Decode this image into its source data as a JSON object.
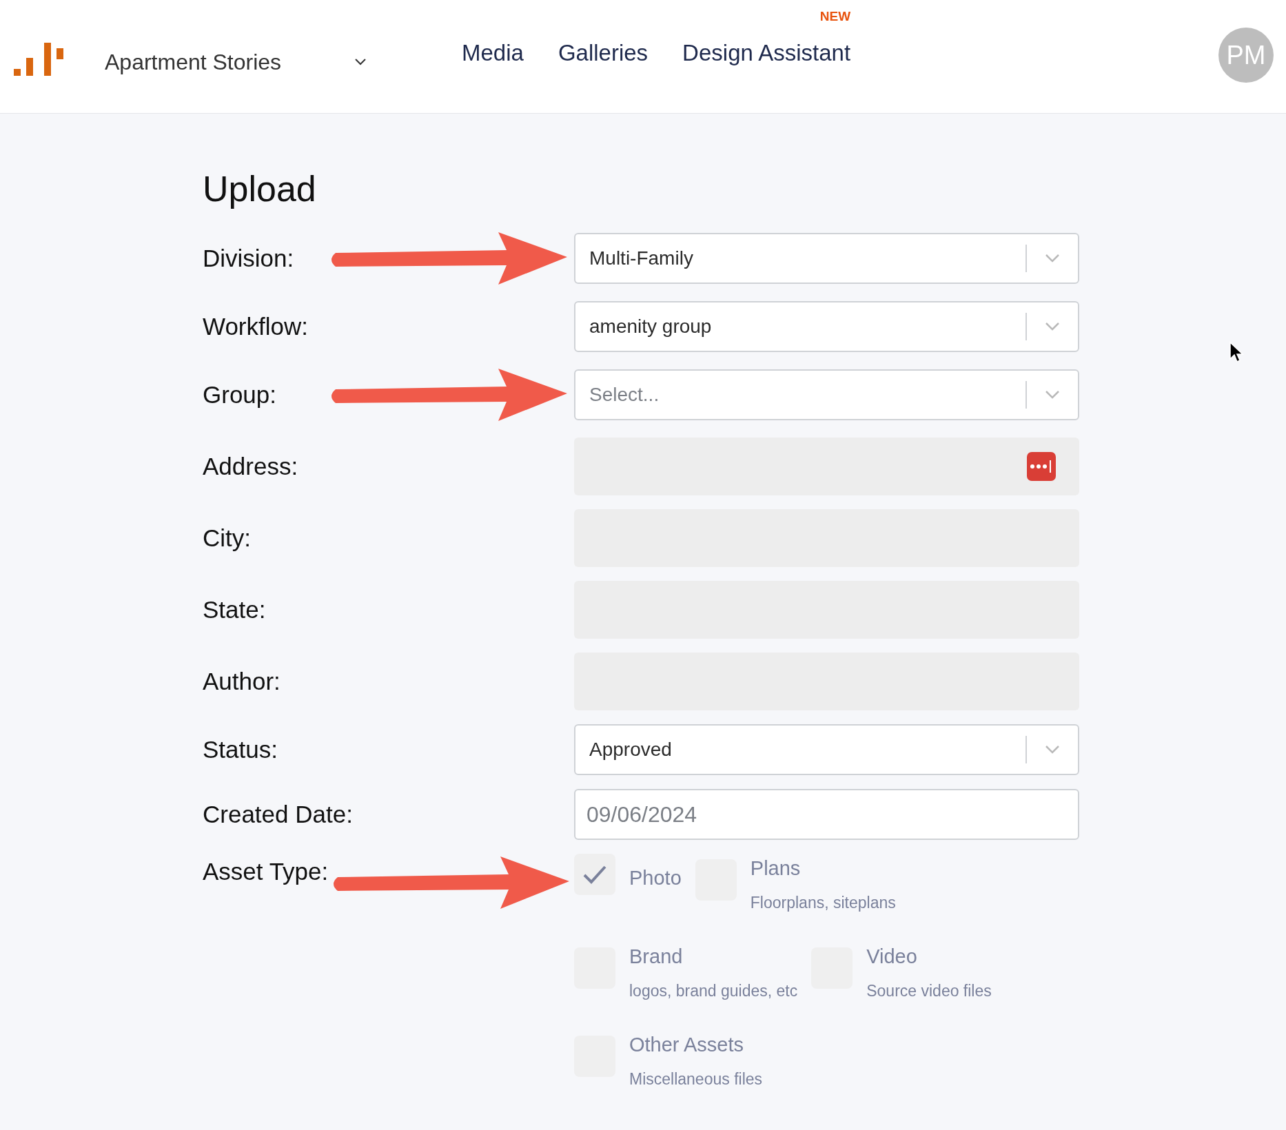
{
  "header": {
    "project": "Apartment Stories",
    "nav": [
      {
        "label": "Media"
      },
      {
        "label": "Galleries"
      },
      {
        "label": "Design Assistant",
        "badge": "NEW"
      }
    ],
    "avatar": "PM"
  },
  "page_title": "Upload",
  "fields": [
    {
      "label": "Division:",
      "kind": "select",
      "value": "Multi-Family",
      "arrow": true
    },
    {
      "label": "Workflow:",
      "kind": "select",
      "value": "amenity group",
      "arrow": false
    },
    {
      "label": "Group:",
      "kind": "select",
      "placeholder": "Select...",
      "arrow": true
    },
    {
      "label": "Address:",
      "kind": "disabled",
      "password_icon": true,
      "arrow": false
    },
    {
      "label": "City:",
      "kind": "disabled",
      "password_icon": false,
      "arrow": false
    },
    {
      "label": "State:",
      "kind": "disabled",
      "password_icon": false,
      "arrow": false
    },
    {
      "label": "Author:",
      "kind": "disabled",
      "password_icon": false,
      "arrow": false
    },
    {
      "label": "Status:",
      "kind": "select",
      "value": "Approved",
      "arrow": false
    },
    {
      "label": "Created Date:",
      "kind": "date",
      "value": "09/06/2024",
      "arrow": false
    }
  ],
  "asset_type": {
    "label": "Asset Type:",
    "arrow": true,
    "options": [
      {
        "name": "Photo",
        "checked": true
      },
      {
        "name": "Plans",
        "description": "Floorplans, siteplans",
        "checked": false
      },
      {
        "name": "Brand",
        "description": "logos, brand guides, etc",
        "checked": false
      },
      {
        "name": "Video",
        "description": "Source video files",
        "checked": false
      },
      {
        "name": "Other Assets",
        "description": "Miscellaneous files",
        "checked": false
      }
    ]
  }
}
